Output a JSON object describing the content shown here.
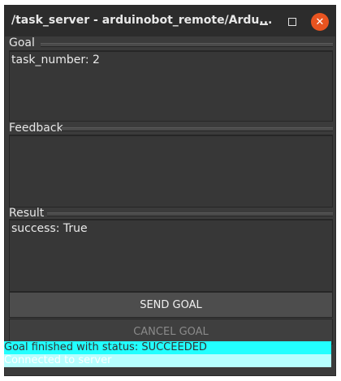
{
  "window": {
    "title": "/task_server - arduinobot_remote/Ardu...",
    "close_glyph": "✕"
  },
  "goal": {
    "label": "Goal",
    "text": "task_number: 2"
  },
  "feedback": {
    "label": "Feedback",
    "text": ""
  },
  "result": {
    "label": "Result",
    "text": "success: True"
  },
  "buttons": {
    "send_label": "SEND GOAL",
    "cancel_label": "CANCEL GOAL"
  },
  "status": {
    "line1": "Goal finished with status: SUCCEEDED",
    "line2": "Connected to server"
  },
  "colors": {
    "background": "#3b3b3b",
    "titlebar": "#2c2c2c",
    "close_button": "#e95420",
    "status_highlight": "#22ffff",
    "status_secondary": "#b6ffff"
  },
  "icons": {
    "minimize": "minimize-icon",
    "maximize": "maximize-icon",
    "close": "close-icon"
  }
}
